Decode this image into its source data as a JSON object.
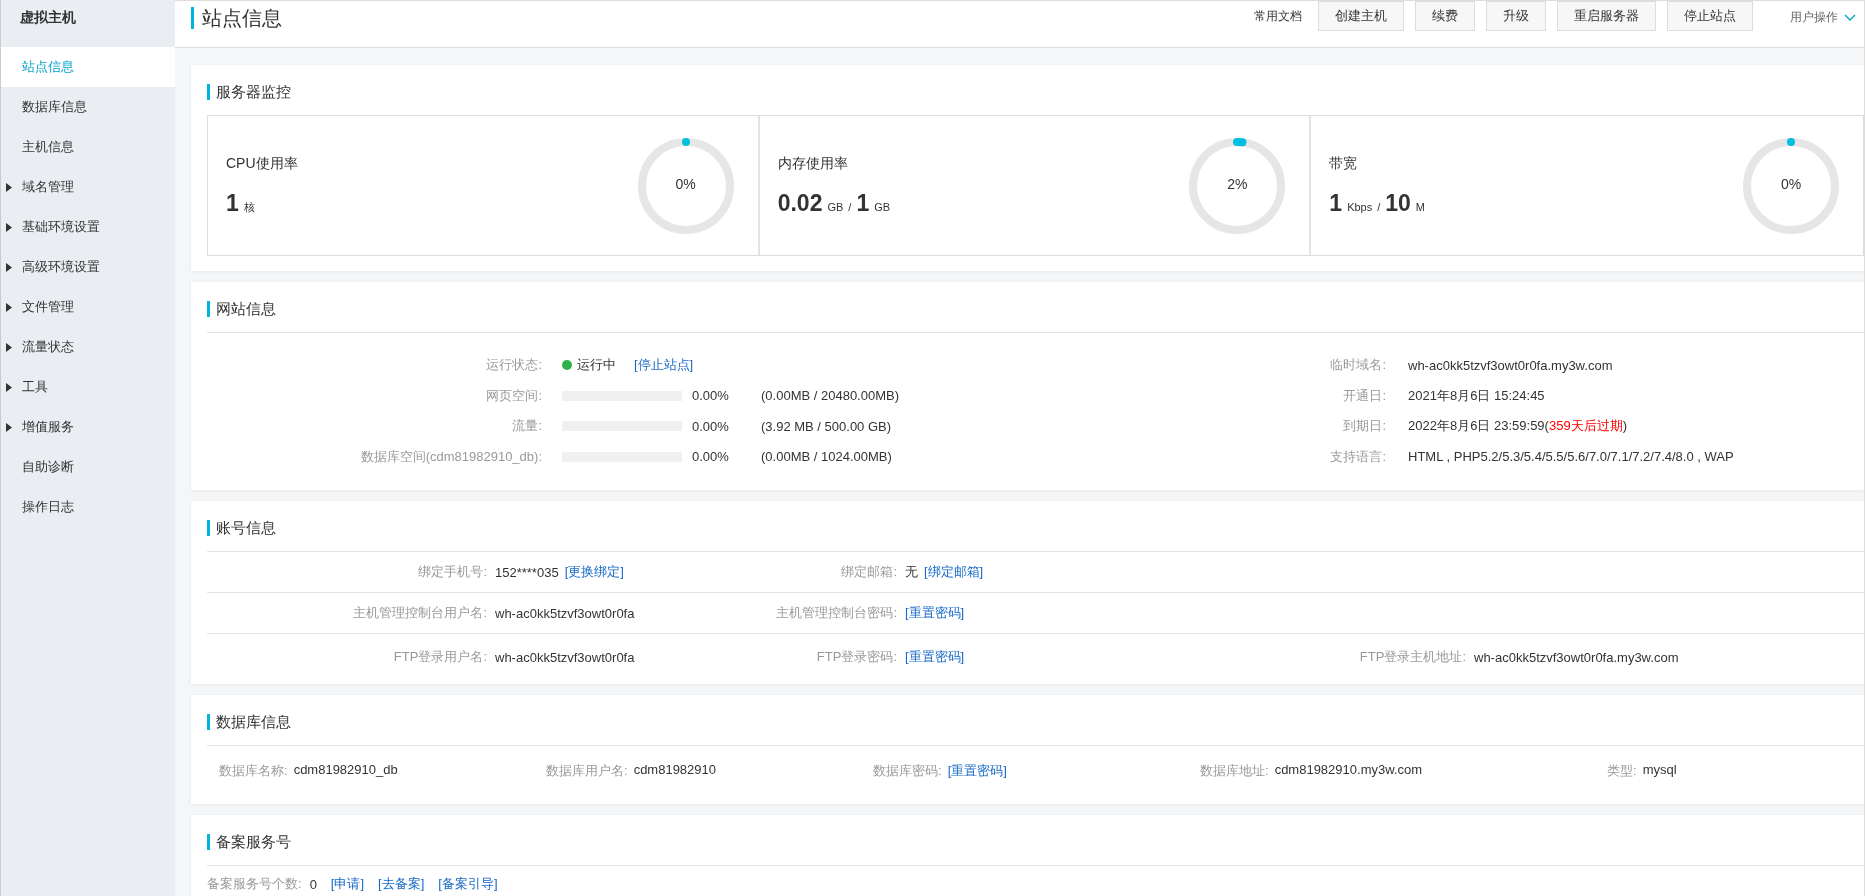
{
  "sidebar": {
    "title": "虚拟主机",
    "items": [
      {
        "label": "站点信息",
        "selected": true,
        "expandable": false
      },
      {
        "label": "数据库信息",
        "selected": false,
        "expandable": false
      },
      {
        "label": "主机信息",
        "selected": false,
        "expandable": false
      },
      {
        "label": "域名管理",
        "selected": false,
        "expandable": true
      },
      {
        "label": "基础环境设置",
        "selected": false,
        "expandable": true
      },
      {
        "label": "高级环境设置",
        "selected": false,
        "expandable": true
      },
      {
        "label": "文件管理",
        "selected": false,
        "expandable": true
      },
      {
        "label": "流量状态",
        "selected": false,
        "expandable": true
      },
      {
        "label": "工具",
        "selected": false,
        "expandable": true
      },
      {
        "label": "增值服务",
        "selected": false,
        "expandable": true
      },
      {
        "label": "自助诊断",
        "selected": false,
        "expandable": false
      },
      {
        "label": "操作日志",
        "selected": false,
        "expandable": false
      }
    ]
  },
  "header": {
    "title": "站点信息",
    "docs_link": "常用文档",
    "buttons": [
      "创建主机",
      "续费",
      "升级",
      "重启服务器",
      "停止站点"
    ],
    "user_menu": "用户操作"
  },
  "monitor": {
    "title": "服务器监控",
    "gauges": [
      {
        "label": "CPU使用率",
        "value": "1",
        "unit": "核",
        "percent": "0%",
        "level": 0
      },
      {
        "label": "内存使用率",
        "value": "0.02",
        "unit": "GB",
        "separator": "/",
        "total": "1",
        "total_unit": "GB",
        "percent": "2%",
        "level": 0.02
      },
      {
        "label": "带宽",
        "value": "1",
        "unit": "Kbps",
        "separator": "/",
        "total": "10",
        "total_unit": "M",
        "percent": "0%",
        "level": 0
      }
    ]
  },
  "website": {
    "title": "网站信息",
    "left": [
      {
        "kind": "status",
        "label": "运行状态:",
        "running": true,
        "status": "运行中",
        "link": "[停止站点]"
      },
      {
        "kind": "usage",
        "label": "网页空间:",
        "level": 0,
        "percent": "0.00%",
        "detail": "(0.00MB / 20480.00MB)"
      },
      {
        "kind": "usage",
        "label": "流量:",
        "level": 0,
        "percent": "0.00%",
        "detail": "(3.92 MB / 500.00 GB)"
      },
      {
        "kind": "usage",
        "label": "数据库空间(cdm81982910_db):",
        "level": 0,
        "percent": "0.00%",
        "detail": "(0.00MB / 1024.00MB)"
      }
    ],
    "right": [
      {
        "label": "临时域名:",
        "value": "wh-ac0kk5tzvf3owt0r0fa.my3w.com"
      },
      {
        "label": "开通日:",
        "value": "2021年8月6日 15:24:45"
      },
      {
        "label": "到期日:",
        "value": "2022年8月6日 23:59:59(",
        "warning": "359天后过期",
        "value_end": ")"
      },
      {
        "label": "支持语言:",
        "value": "HTML , PHP5.2/5.3/5.4/5.5/5.6/7.0/7.1/7.2/7.4/8.0 , WAP"
      }
    ]
  },
  "account": {
    "title": "账号信息",
    "rows": [
      {
        "cells": [
          {
            "label": "绑定手机号:",
            "value": "152****035",
            "link": "[更换绑定]"
          },
          {
            "label": "绑定邮箱:",
            "value": "无",
            "link": "[绑定邮箱]"
          }
        ]
      },
      {
        "cells": [
          {
            "label": "主机管理控制台用户名:",
            "value": "wh-ac0kk5tzvf3owt0r0fa"
          },
          {
            "label": "主机管理控制台密码:",
            "link": "[重置密码]"
          }
        ]
      },
      {
        "cells": [
          {
            "label": "FTP登录用户名:",
            "value": "wh-ac0kk5tzvf3owt0r0fa"
          },
          {
            "label": "FTP登录密码:",
            "link": "[重置密码]"
          },
          {
            "label": "FTP登录主机地址:",
            "value": "wh-ac0kk5tzvf3owt0r0fa.my3w.com"
          }
        ]
      }
    ]
  },
  "database": {
    "title": "数据库信息",
    "cells": [
      {
        "label": "数据库名称:",
        "value": "cdm81982910_db"
      },
      {
        "label": "数据库用户名:",
        "value": "cdm81982910"
      },
      {
        "label": "数据库密码:",
        "link": "[重置密码]"
      },
      {
        "label": "数据库地址:",
        "value": "cdm81982910.my3w.com"
      },
      {
        "label": "类型:",
        "value": "mysql"
      }
    ]
  },
  "record": {
    "title": "备案服务号",
    "label": "备案服务号个数:",
    "count": "0",
    "links": [
      "[申请]",
      "[去备案]",
      "[备案引导]"
    ]
  }
}
